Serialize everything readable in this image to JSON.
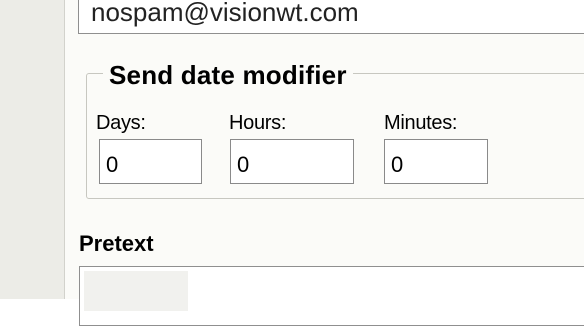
{
  "recipient_field": {
    "value": "nospam@visionwt.com"
  },
  "send_date_modifier": {
    "legend": "Send date modifier",
    "days": {
      "label": "Days:",
      "value": "0"
    },
    "hours": {
      "label": "Hours:",
      "value": "0"
    },
    "minutes": {
      "label": "Minutes:",
      "value": "0"
    }
  },
  "pretext": {
    "title": "Pretext",
    "value": ""
  }
}
